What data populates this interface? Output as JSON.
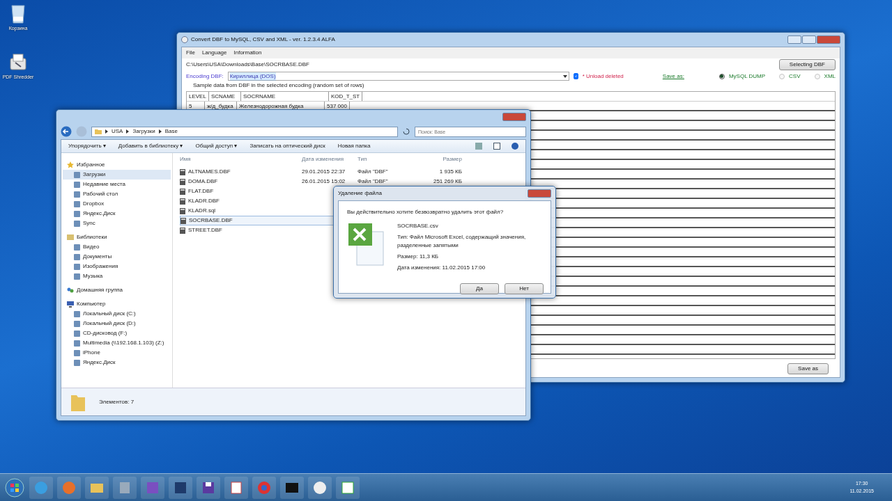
{
  "desktop_icons": [
    {
      "label": "Корзина",
      "kind": "bin"
    },
    {
      "label": "PDF Shredder",
      "kind": "shredder"
    }
  ],
  "converter": {
    "title": "Convert DBF to MySQL, CSV and XML - ver. 1.2.3.4 ALFA",
    "menu": [
      "File",
      "Language",
      "Information"
    ],
    "path": "C:\\Users\\USA\\Downloads\\Base\\SOCRBASE.DBF",
    "select_button": "Selecting DBF",
    "encoding_label": "Encoding DBF:",
    "encoding_value": "Кириллица (DOS)",
    "unload_deleted": {
      "label": "* Unload deleted",
      "checked": true
    },
    "save_as_label": "Save as:",
    "formats": [
      {
        "label": "MySQL DUMP",
        "selected": true
      },
      {
        "label": "CSV",
        "selected": false
      },
      {
        "label": "XML",
        "selected": false
      }
    ],
    "sample_caption": "Sample data from DBF in the selected encoding (random set of rows)",
    "table": {
      "columns": [
        "LEVEL",
        "SCNAME",
        "SOCRNAME",
        "KOD_T_ST"
      ],
      "rows": [
        [
          "5",
          "ж/д_будка",
          "Железнодорожная будка",
          "537 000"
        ]
      ]
    },
    "save_button": "Save as"
  },
  "explorer": {
    "breadcrumb": [
      "USA",
      "Загрузки",
      "Base"
    ],
    "search_placeholder": "Поиск: Base",
    "toolbar": [
      "Упорядочить ▾",
      "Добавить в библиотеку ▾",
      "Общий доступ ▾",
      "Записать на оптический диск",
      "Новая папка"
    ],
    "nav": [
      {
        "label": "Избранное",
        "kind": "star",
        "children": [
          {
            "label": "Загрузки",
            "selected": true
          },
          {
            "label": "Недавние места",
            "selected": false
          },
          {
            "label": "Рабочий стол",
            "selected": false
          },
          {
            "label": "Dropbox",
            "selected": false
          },
          {
            "label": "Яндекс.Диск",
            "selected": false
          },
          {
            "label": "Sync",
            "selected": false
          }
        ]
      },
      {
        "label": "Библиотеки",
        "kind": "library",
        "children": [
          {
            "label": "Видео",
            "selected": false
          },
          {
            "label": "Документы",
            "selected": false
          },
          {
            "label": "Изображения",
            "selected": false
          },
          {
            "label": "Музыка",
            "selected": false
          }
        ]
      },
      {
        "label": "Домашняя группа",
        "kind": "group"
      },
      {
        "label": "Компьютер",
        "kind": "computer",
        "children": [
          {
            "label": "Локальный диск (C:)",
            "selected": false
          },
          {
            "label": "Локальный диск (D:)",
            "selected": false
          },
          {
            "label": "CD-дисковод (F:)",
            "selected": false
          },
          {
            "label": "Multimedia (\\\\192.168.1.103) (Z:)",
            "selected": false
          },
          {
            "label": "iPhone",
            "selected": false
          },
          {
            "label": "Яндекс.Диск",
            "selected": false
          }
        ]
      }
    ],
    "columns": [
      "Имя",
      "Дата изменения",
      "Тип",
      "Размер"
    ],
    "files": [
      {
        "name": "ALTNAMES.DBF",
        "date": "29.01.2015 22:37",
        "type": "Файл \"DBF\"",
        "size": "1 935 КБ",
        "selected": false
      },
      {
        "name": "DOMA.DBF",
        "date": "26.01.2015 15:02",
        "type": "Файл \"DBF\"",
        "size": "251 269 КБ",
        "selected": false
      },
      {
        "name": "FLAT.DBF",
        "selected": false
      },
      {
        "name": "KLADR.DBF",
        "selected": false
      },
      {
        "name": "KLADR.sql",
        "selected": false
      },
      {
        "name": "SOCRBASE.DBF",
        "selected": true
      },
      {
        "name": "STREET.DBF",
        "selected": false
      }
    ],
    "status": "Элементов: 7"
  },
  "dialog": {
    "title": "Удаление файла",
    "question": "Вы действительно хотите безвозвратно удалить этот файл?",
    "file_name": "SOCRBASE.csv",
    "details": [
      "Тип: Файл Microsoft Excel, содержащий значения, разделенные запятыми",
      "Размер: 11,3 КБ",
      "Дата изменения: 11.02.2015 17:00"
    ],
    "buttons": [
      "Да",
      "Нет"
    ]
  },
  "taskbar": {
    "time": "17:30",
    "date": "11.02.2015"
  }
}
